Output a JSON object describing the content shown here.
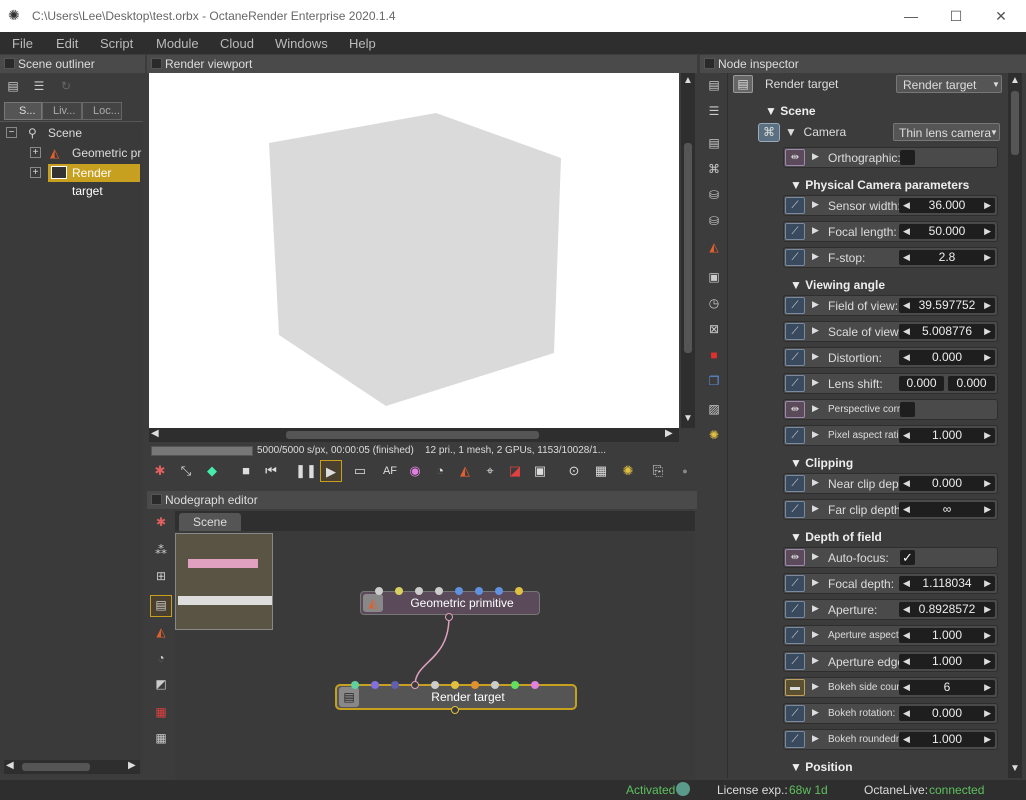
{
  "window": {
    "title": "C:\\Users\\Lee\\Desktop\\test.orbx - OctaneRender Enterprise 2020.1.4",
    "minimize": "—",
    "maximize": "☐",
    "close": "✕"
  },
  "menu": [
    "File",
    "Edit",
    "Script",
    "Module",
    "Cloud",
    "Windows",
    "Help"
  ],
  "outliner": {
    "title": "Scene outliner",
    "tabs": [
      "S...",
      "Liv...",
      "Loc..."
    ],
    "items": [
      {
        "label": "Scene",
        "expander": "−"
      },
      {
        "label": "Geometric prim",
        "expander": "+"
      },
      {
        "label": "Render target",
        "expander": "+",
        "selected": true
      }
    ]
  },
  "viewport": {
    "title": "Render viewport",
    "samples": "5000/5000 s/px, 00:00:05 (finished)",
    "stats": "12 pri., 1 mesh, 2 GPUs, 1153/10028/1...",
    "progress": 1.0
  },
  "nodegraph": {
    "title": "Nodegraph editor",
    "tab": "Scene",
    "node1": "Geometric primitive",
    "node2": "Render target"
  },
  "inspector": {
    "title": "Node inspector",
    "rt_label": "Render target",
    "rt_dropdown": "Render target",
    "scene_section": "Scene",
    "camera_label": "Camera",
    "camera_dropdown": "Thin lens camera",
    "orthographic": "Orthographic:",
    "physical_section": "Physical Camera parameters",
    "sensor_width": {
      "label": "Sensor width:",
      "value": "36.000"
    },
    "focal_length": {
      "label": "Focal length:",
      "value": "50.000"
    },
    "fstop": {
      "label": "F-stop:",
      "value": "2.8"
    },
    "viewing_section": "Viewing angle",
    "fov": {
      "label": "Field of view:",
      "value": "39.597752"
    },
    "scale_of_view": {
      "label": "Scale of view:",
      "value": "5.008776"
    },
    "distortion": {
      "label": "Distortion:",
      "value": "0.000"
    },
    "lens_shift": {
      "label": "Lens shift:",
      "value_x": "0.000",
      "value_y": "0.000"
    },
    "perspective": "Perspective corre...",
    "pixel_aspect": {
      "label": "Pixel aspect ratio:",
      "value": "1.000"
    },
    "clipping_section": "Clipping",
    "near_clip": {
      "label": "Near clip depth:",
      "value": "0.000"
    },
    "far_clip": {
      "label": "Far clip depth:",
      "value": "∞"
    },
    "dof_section": "Depth of field",
    "autofocus": {
      "label": "Auto-focus:",
      "check": "✓"
    },
    "focal_depth": {
      "label": "Focal depth:",
      "value": "1.118034"
    },
    "aperture": {
      "label": "Aperture:",
      "value": "0.8928572"
    },
    "aperture_aspect": {
      "label": "Aperture aspect r...",
      "value": "1.000"
    },
    "aperture_edge": {
      "label": "Aperture edge:",
      "value": "1.000"
    },
    "bokeh_count": {
      "label": "Bokeh side count:",
      "value": "6"
    },
    "bokeh_rotation": {
      "label": "Bokeh rotation:",
      "value": "0.000"
    },
    "bokeh_roundness": {
      "label": "Bokeh roundedness:",
      "value": "1.000"
    },
    "position_section": "Position"
  },
  "statusbar": {
    "activated": "Activated",
    "license_label": "License exp.:",
    "license_value": "68w 1d",
    "live_label": "OctaneLive:",
    "live_value": "connected"
  },
  "colors": {
    "accent_green": "#5ec15e",
    "selection": "#c8a020",
    "node_border_selected": "#c8a020"
  }
}
